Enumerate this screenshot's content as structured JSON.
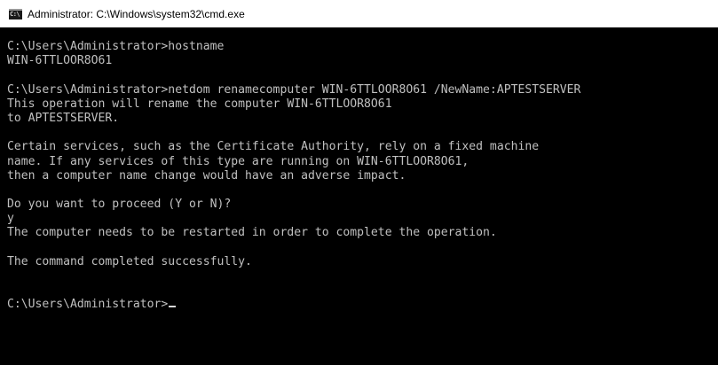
{
  "window": {
    "title": "Administrator: C:\\Windows\\system32\\cmd.exe",
    "icon": "cmd-icon",
    "icon_glyph": "C:\\"
  },
  "console": {
    "lines": [
      "C:\\Users\\Administrator>hostname",
      "WIN-6TTLOOR8O61",
      "",
      "C:\\Users\\Administrator>netdom renamecomputer WIN-6TTLOOR8O61 /NewName:APTESTSERVER",
      "This operation will rename the computer WIN-6TTLOOR8O61",
      "to APTESTSERVER.",
      "",
      "Certain services, such as the Certificate Authority, rely on a fixed machine",
      "name. If any services of this type are running on WIN-6TTLOOR8O61,",
      "then a computer name change would have an adverse impact.",
      "",
      "Do you want to proceed (Y or N)?",
      "y",
      "The computer needs to be restarted in order to complete the operation.",
      "",
      "The command completed successfully.",
      "",
      "",
      "C:\\Users\\Administrator>"
    ],
    "colors": {
      "background": "#000000",
      "text": "#c0c0c0",
      "titlebar": "#ffffff"
    }
  }
}
